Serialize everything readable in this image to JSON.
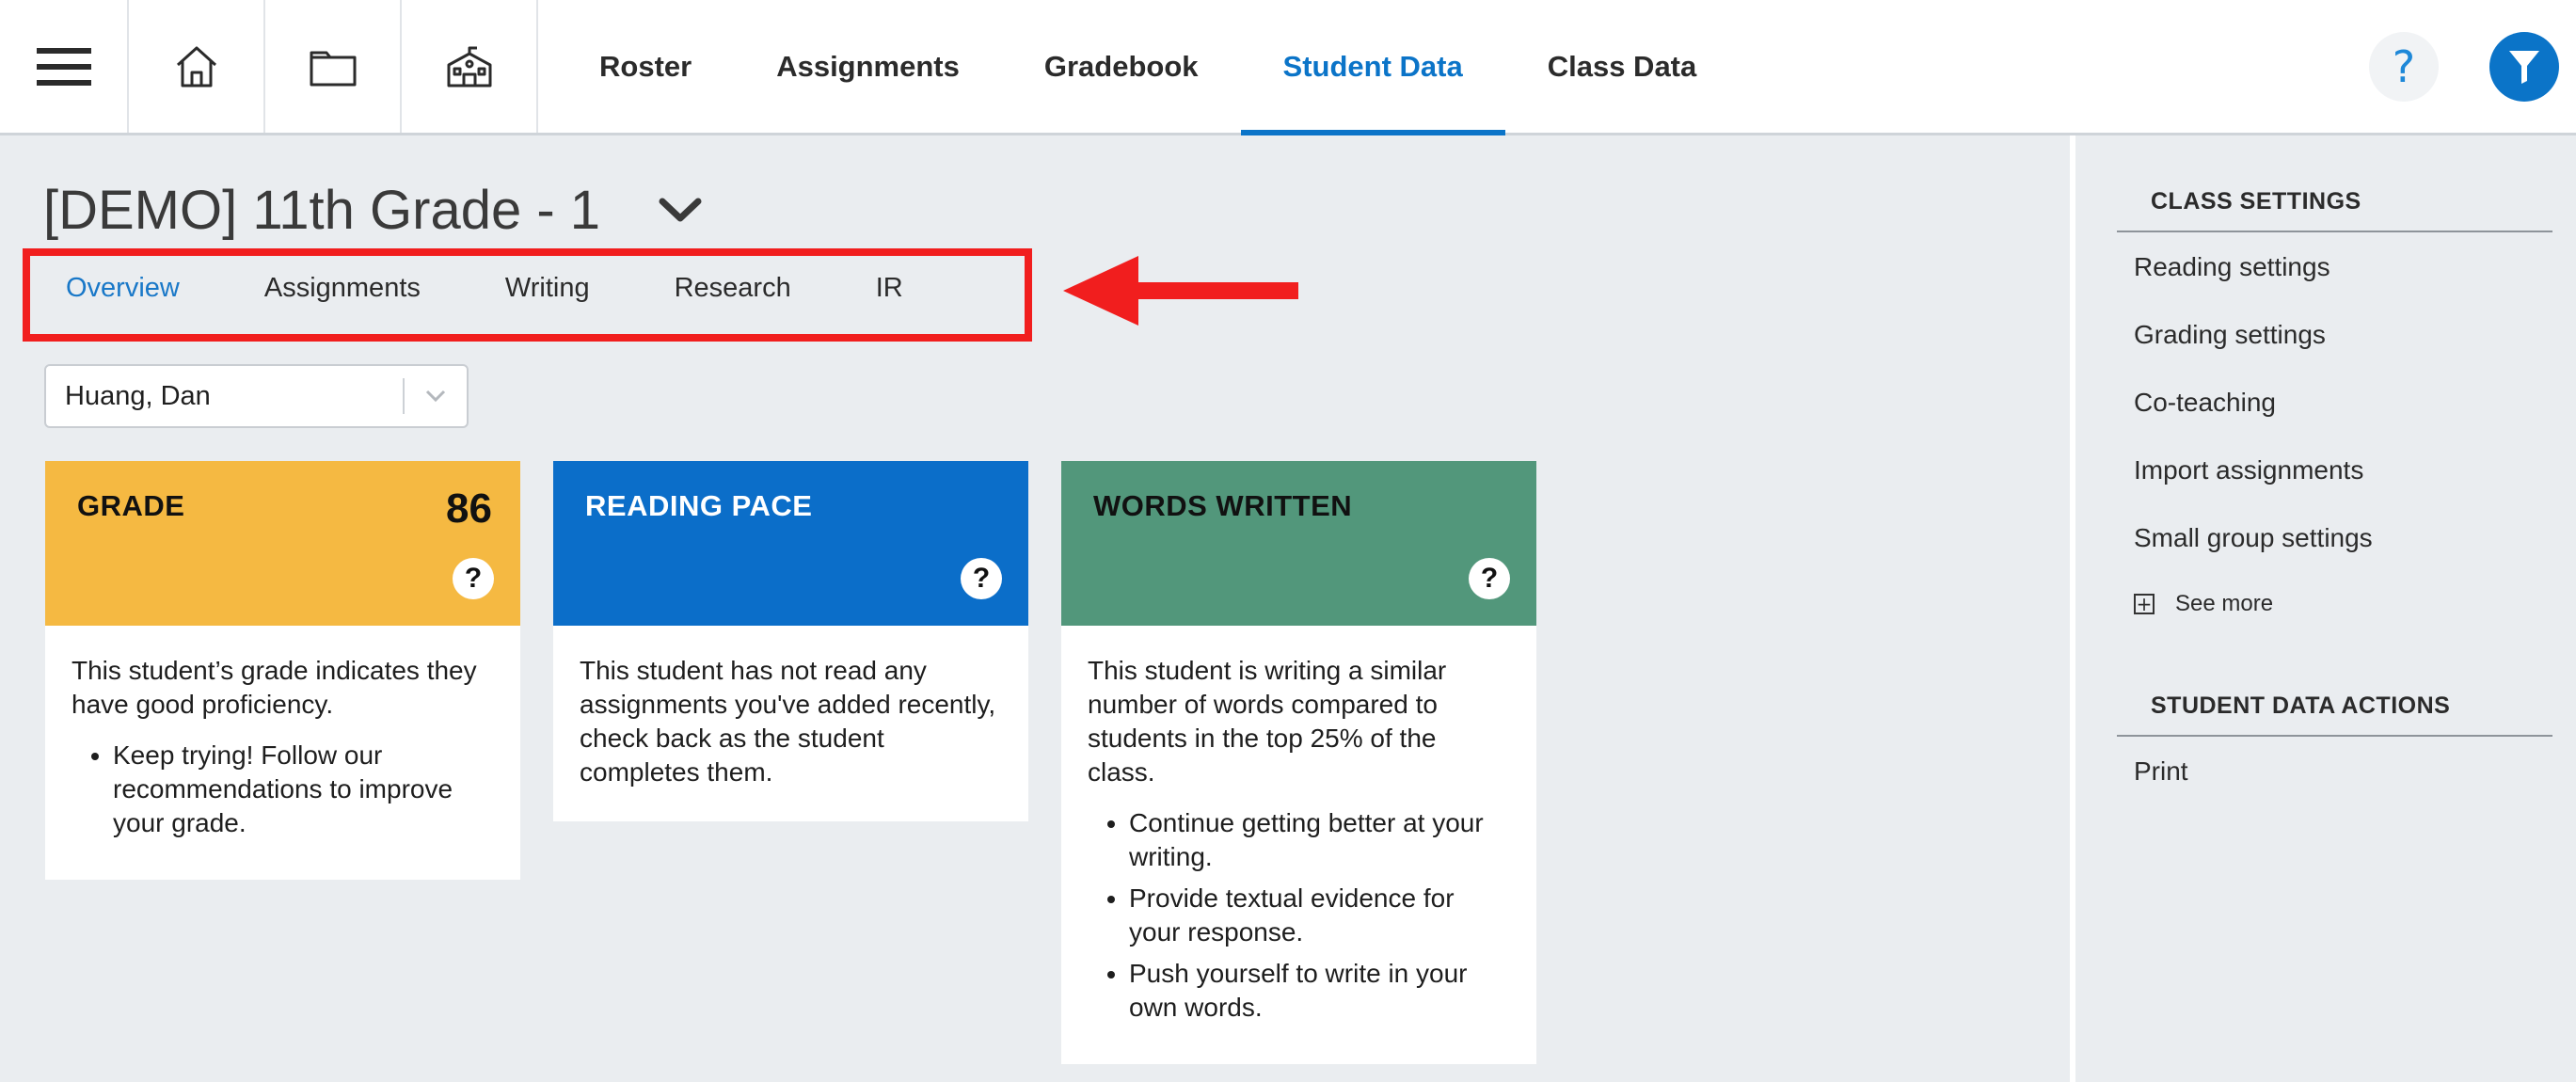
{
  "topnav": {
    "tabs": [
      {
        "label": "Roster"
      },
      {
        "label": "Assignments"
      },
      {
        "label": "Gradebook"
      },
      {
        "label": "Student Data",
        "active": true
      },
      {
        "label": "Class Data"
      }
    ],
    "help_label": "?",
    "icons": [
      "hamburger-menu-icon",
      "home-icon",
      "folder-icon",
      "school-icon",
      "help-icon",
      "filter-icon"
    ],
    "accent_color": "#0b74c8"
  },
  "class": {
    "title": "[DEMO] 11th Grade - 1"
  },
  "subtabs": [
    {
      "label": "Overview",
      "active": true
    },
    {
      "label": "Assignments"
    },
    {
      "label": "Writing"
    },
    {
      "label": "Research"
    },
    {
      "label": "IR"
    }
  ],
  "student_select": {
    "value": "Huang, Dan"
  },
  "cards": {
    "grade": {
      "title": "GRADE",
      "value": "86",
      "help": "?",
      "text": "This student’s grade indicates they have good proficiency.",
      "bullets": [
        "Keep trying! Follow our recommendations to improve your grade."
      ],
      "color": "#f5b942"
    },
    "pace": {
      "title": "READING PACE",
      "help": "?",
      "text": "This student has not read any assignments you've added recently, check back as the student completes them.",
      "color": "#0b6ec9"
    },
    "words": {
      "title": "WORDS WRITTEN",
      "help": "?",
      "text": "This student is writing a similar number of words compared to students in the top 25% of the class.",
      "bullets": [
        "Continue getting better at your writing.",
        "Provide textual evidence for your response.",
        "Push yourself to write in your own words."
      ],
      "color": "#52977b"
    }
  },
  "sidebar": {
    "class_settings_heading": "CLASS SETTINGS",
    "class_settings": [
      "Reading settings",
      "Grading settings",
      "Co-teaching",
      "Import assignments",
      "Small group settings"
    ],
    "see_more": "See more",
    "actions_heading": "STUDENT DATA ACTIONS",
    "actions": [
      "Print"
    ]
  },
  "annotation": {
    "highlight_color": "#f11e1e"
  }
}
